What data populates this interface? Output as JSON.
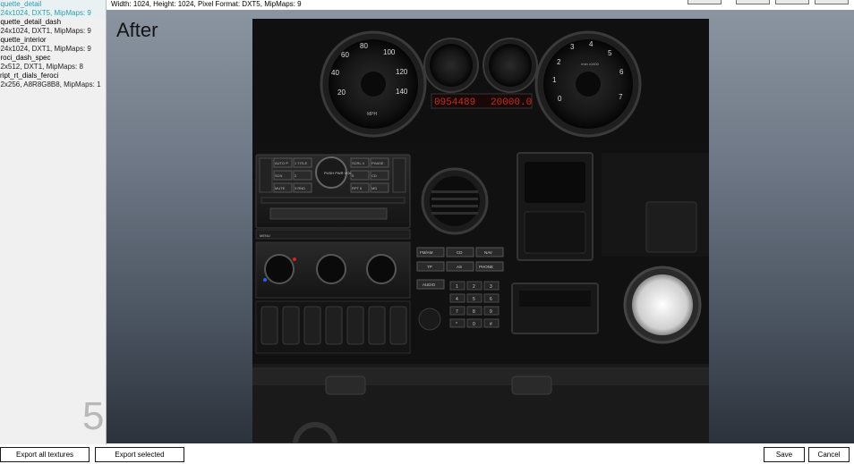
{
  "textures": [
    {
      "name": "oquette_detail",
      "info": "024x1024, DXT5, MipMaps: 9",
      "selected": true
    },
    {
      "name": "oquette_detail_dash",
      "info": "024x1024, DXT1, MipMaps: 9"
    },
    {
      "name": "oquette_interior",
      "info": "024x1024, DXT1, MipMaps: 9"
    },
    {
      "name": "eroci_dash_spec",
      "info": "12x512, DXT1, MipMaps: 8"
    },
    {
      "name": "cript_rt_dials_feroci",
      "info": "12x256, A8R8G8B8, MipMaps: 1"
    }
  ],
  "info_line": "Width: 1024, Height: 1024, Pixel Format: DXT5, MipMaps: 9",
  "preview": {
    "label": "After",
    "page_number": "5",
    "odometer": "0954489",
    "trip": "20000.0",
    "speed_ticks": [
      "20",
      "40",
      "60",
      "80",
      "100",
      "120",
      "140"
    ],
    "speed_unit": "MPH",
    "tach_ticks": [
      "0",
      "1",
      "2",
      "3",
      "4",
      "5",
      "6",
      "7"
    ],
    "tach_unit": "rmin x1000",
    "radio_buttons": [
      "AUTO·P",
      "1 TITLE",
      "SCN",
      "2",
      "MUTE",
      "3 RND",
      "SCRL 4",
      "5",
      "RPT 6",
      "PHASE",
      "CD",
      "MD"
    ],
    "radio_knob": "PUSH PWR VOL",
    "nav_buttons": [
      "FM/AM",
      "CD",
      "NAV",
      "TP",
      "AS",
      "PHONE",
      "AUDIO"
    ],
    "keypad": [
      "1",
      "2",
      "3",
      "4",
      "5",
      "6",
      "7",
      "8",
      "9",
      "*",
      "0",
      "#"
    ],
    "menu_label": "MENU"
  },
  "buttons": {
    "export_all": "Export all textures",
    "export_selected": "Export selected",
    "save": "Save",
    "cancel": "Cancel"
  }
}
